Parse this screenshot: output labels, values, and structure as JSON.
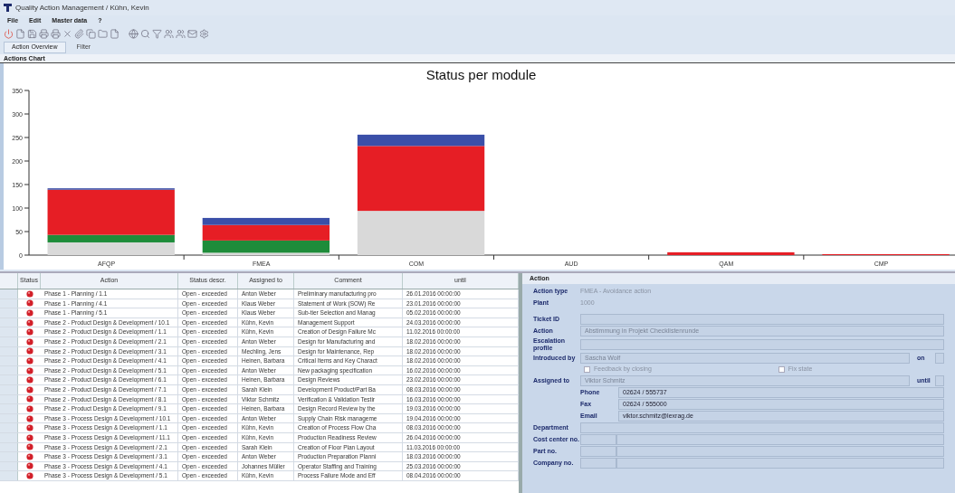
{
  "window": {
    "title": "Quality Action Management / Kühn, Kevin"
  },
  "menu": [
    "File",
    "Edit",
    "Master data",
    "?"
  ],
  "tabs": [
    {
      "label": "Action Overview",
      "selected": true
    },
    {
      "label": "Filter",
      "selected": false
    }
  ],
  "chart_section": {
    "title": "Actions Chart",
    "chart_data": {
      "type": "bar",
      "stacked": true,
      "title": "Status per module",
      "categories": [
        "AFQP",
        "FMEA",
        "COM",
        "AUD",
        "QAM",
        "CMP"
      ],
      "ylim": [
        0,
        350
      ],
      "yticks": [
        0,
        50,
        100,
        150,
        200,
        250,
        300,
        350
      ],
      "series": [
        {
          "color": "#d9d9d9",
          "values": [
            27,
            5,
            94,
            0,
            0,
            0
          ]
        },
        {
          "color": "#1e8c3a",
          "values": [
            16,
            26,
            0,
            0,
            0,
            0
          ]
        },
        {
          "color": "#e61e25",
          "values": [
            96,
            33,
            138,
            0,
            6,
            2
          ]
        },
        {
          "color": "#3a4fa8",
          "values": [
            3,
            15,
            24,
            0,
            0,
            0
          ]
        }
      ]
    }
  },
  "table": {
    "columns": [
      "Status",
      "Action",
      "Status descr.",
      "Assigned to",
      "Comment",
      "until"
    ],
    "rows": [
      [
        "",
        "Phase 1 - Planning / 1.1",
        "Open - exceeded",
        "Anton Weber",
        "Preliminary manufacturing pro",
        "26.01.2016 00:00:00"
      ],
      [
        "",
        "Phase 1 - Planning / 4.1",
        "Open - exceeded",
        "Klaus Weber",
        "Statement of Work (SOW) Re",
        "23.01.2016 00:00:00"
      ],
      [
        "",
        "Phase 1 - Planning / 5.1",
        "Open - exceeded",
        "Klaus Weber",
        "Sub-tier Selection and Manag",
        "05.02.2016 00:00:00"
      ],
      [
        "",
        "Phase 2 - Product Design & Development / 10.1",
        "Open - exceeded",
        "Kühn, Kevin",
        "Management Support",
        "24.03.2016 00:00:00"
      ],
      [
        "",
        "Phase 2 - Product Design & Development / 1.1",
        "Open - exceeded",
        "Kühn, Kevin",
        "Creation of Design Failure Mc",
        "11.02.2016 00:00:00"
      ],
      [
        "",
        "Phase 2 - Product Design & Development / 2.1",
        "Open - exceeded",
        "Anton Weber",
        "Design for Manufacturing and",
        "18.02.2016 00:00:00"
      ],
      [
        "",
        "Phase 2 - Product Design & Development / 3.1",
        "Open - exceeded",
        "Mechling, Jens",
        "Design for Maintenance, Rep",
        "18.02.2016 00:00:00"
      ],
      [
        "",
        "Phase 2 - Product Design & Development / 4.1",
        "Open - exceeded",
        "Heinen, Barbara",
        "Critical Items and Key Charact",
        "18.02.2016 00:00:00"
      ],
      [
        "",
        "Phase 2 - Product Design & Development / 5.1",
        "Open - exceeded",
        "Anton Weber",
        "New packaging specification",
        "16.02.2016 00:00:00"
      ],
      [
        "",
        "Phase 2 - Product Design & Development / 6.1",
        "Open - exceeded",
        "Heinen, Barbara",
        "Design Reviews",
        "23.02.2016 00:00:00"
      ],
      [
        "",
        "Phase 2 - Product Design & Development / 7.1",
        "Open - exceeded",
        "Sarah Klein",
        "Development Product/Part Ba",
        "08.03.2016 00:00:00"
      ],
      [
        "",
        "Phase 2 - Product Design & Development / 8.1",
        "Open - exceeded",
        "Viktor Schmitz",
        "Verification & Validation Testir",
        "16.03.2016 00:00:00"
      ],
      [
        "",
        "Phase 2 - Product Design & Development / 9.1",
        "Open - exceeded",
        "Heinen, Barbara",
        "Design Record Review by the",
        "19.03.2016 00:00:00"
      ],
      [
        "",
        "Phase 3 - Process Design & Development / 10.1",
        "Open - exceeded",
        "Anton Weber",
        "Supply Chain Risk manageme",
        "19.04.2016 00:00:00"
      ],
      [
        "",
        "Phase 3 - Process Design & Development / 1.1",
        "Open - exceeded",
        "Kühn, Kevin",
        "Creation of Process Flow Cha",
        "08.03.2016 00:00:00"
      ],
      [
        "",
        "Phase 3 - Process Design & Development / 11.1",
        "Open - exceeded",
        "Kühn, Kevin",
        "Production Readiness Review",
        "26.04.2016 00:00:00"
      ],
      [
        "",
        "Phase 3 - Process Design & Development / 2.1",
        "Open - exceeded",
        "Sarah Klein",
        "Creation of Floor Plan Layout",
        "11.03.2016 00:00:00"
      ],
      [
        "",
        "Phase 3 - Process Design & Development / 3.1",
        "Open - exceeded",
        "Anton Weber",
        "Production Preparation Planni",
        "18.03.2016 00:00:00"
      ],
      [
        "",
        "Phase 3 - Process Design & Development / 4.1",
        "Open - exceeded",
        "Johannes Müller",
        "Operator Staffing and Training",
        "25.03.2016 00:00:00"
      ],
      [
        "",
        "Phase 3 - Process Design & Development / 5.1",
        "Open - exceeded",
        "Kühn, Kevin",
        "Process Failure Mode and Eff",
        "08.04.2016 00:00:00"
      ]
    ]
  },
  "detail": {
    "title": "Action",
    "action_type": {
      "label": "Action type",
      "value": "FMEA - Avoidance action"
    },
    "plant": {
      "label": "Plant",
      "value": "1000"
    },
    "ticket_id": {
      "label": "Ticket ID"
    },
    "action": {
      "label": "Action",
      "value": "Abstimmung in Projekt Checklistenrunde"
    },
    "escalation_profile": {
      "label": "Escalation profile"
    },
    "introduced_by": {
      "label": "Introduced by",
      "value": "Sascha Wolf",
      "on_label": "on"
    },
    "checkboxes": [
      {
        "label": "Feedback by closing",
        "checked": false
      },
      {
        "label": "Fix state",
        "checked": false
      }
    ],
    "assigned_to": {
      "label": "Assigned to",
      "value": "Viktor Schmitz",
      "until_label": "until"
    },
    "contact": [
      {
        "label": "Phone",
        "value": "02624 / 555737"
      },
      {
        "label": "Fax",
        "value": "02624 / 555000"
      },
      {
        "label": "Email",
        "value": "viktor.schmitz@lexrag.de"
      }
    ],
    "department": {
      "label": "Department"
    },
    "numbers": [
      {
        "label": "Cost center no."
      },
      {
        "label": "Part no."
      },
      {
        "label": "Company no."
      }
    ]
  }
}
